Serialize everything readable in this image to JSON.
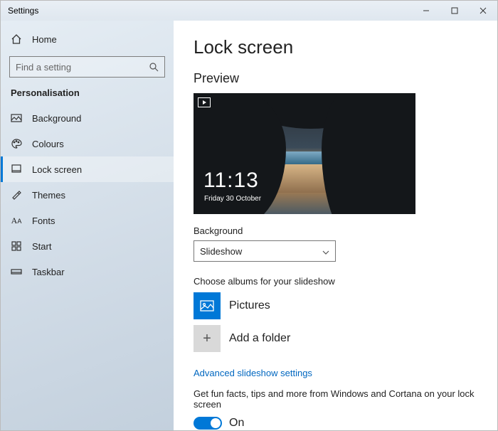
{
  "window": {
    "title": "Settings"
  },
  "sidebar": {
    "home": "Home",
    "search_placeholder": "Find a setting",
    "section": "Personalisation",
    "items": [
      {
        "label": "Background"
      },
      {
        "label": "Colours"
      },
      {
        "label": "Lock screen"
      },
      {
        "label": "Themes"
      },
      {
        "label": "Fonts"
      },
      {
        "label": "Start"
      },
      {
        "label": "Taskbar"
      }
    ]
  },
  "page": {
    "title": "Lock screen",
    "preview_heading": "Preview",
    "clock_time": "11:13",
    "clock_date": "Friday 30 October",
    "background_label": "Background",
    "background_value": "Slideshow",
    "albums_heading": "Choose albums for your slideshow",
    "album_pictures": "Pictures",
    "album_add": "Add a folder",
    "advanced_link": "Advanced slideshow settings",
    "funfacts_text": "Get fun facts, tips and more from Windows and Cortana on your lock screen",
    "toggle_label": "On",
    "toggle_state": true
  }
}
